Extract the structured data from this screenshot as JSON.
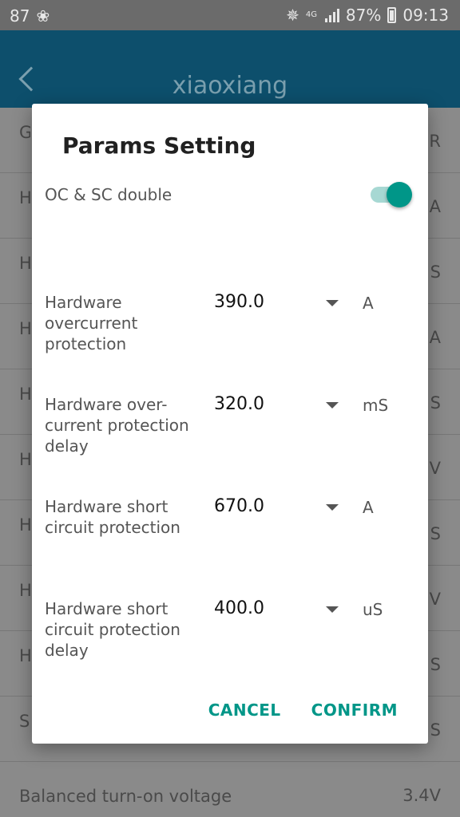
{
  "statusbar": {
    "left_text": "87",
    "network": "4G",
    "battery": "87%",
    "time": "09:13"
  },
  "appbar": {
    "title": "xiaoxiang"
  },
  "background_rows": [
    {
      "label": "G",
      "value": "R"
    },
    {
      "label": "H",
      "value": "A"
    },
    {
      "label": "H",
      "value": "S"
    },
    {
      "label": "H",
      "value": "A"
    },
    {
      "label": "H",
      "value": "S"
    },
    {
      "label": "H",
      "value": "V"
    },
    {
      "label": "H",
      "value": "S"
    },
    {
      "label": "H",
      "value": "V"
    },
    {
      "label": "H",
      "value": "S"
    },
    {
      "label": "S",
      "value": "S"
    }
  ],
  "last_row": {
    "label": "Balanced turn-on voltage",
    "value": "3.4V"
  },
  "dialog": {
    "title": "Params Setting",
    "toggle": {
      "label": "OC & SC double",
      "on": true
    },
    "params": [
      {
        "label": "Hardware overcurrent protection",
        "value": "390.0",
        "unit": "A"
      },
      {
        "label": "Hardware over-current protection delay",
        "value": "320.0",
        "unit": "mS"
      },
      {
        "label": "Hardware short circuit protection",
        "value": "670.0",
        "unit": "A"
      },
      {
        "label": "Hardware short circuit protection delay",
        "value": "400.0",
        "unit": "uS"
      }
    ],
    "cancel_label": "CANCEL",
    "confirm_label": "CONFIRM"
  },
  "colors": {
    "accent": "#009688",
    "appbar": "#0d4f6c"
  },
  "icons": [
    "bluetooth-icon",
    "signal-icon",
    "battery-icon",
    "back-arrow-icon",
    "dropdown-caret-icon"
  ]
}
